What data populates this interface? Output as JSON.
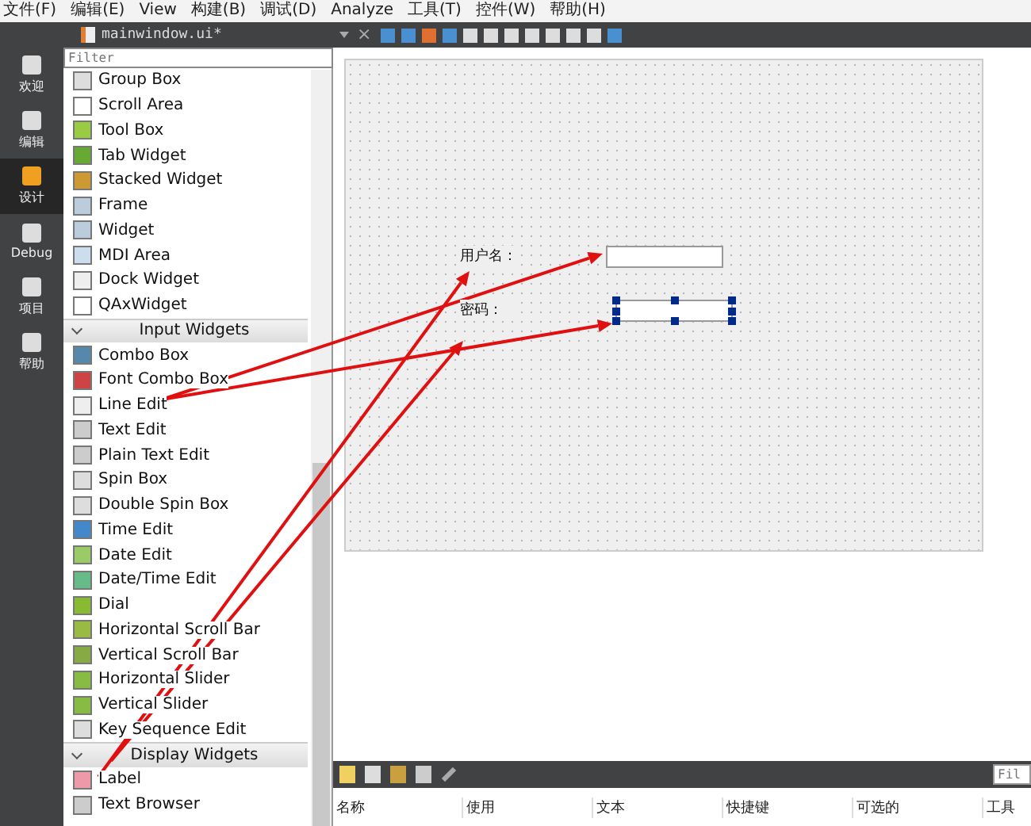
{
  "menu_bar": [
    "文件(F)",
    "编辑(E)",
    "View",
    "构建(B)",
    "调试(D)",
    "Analyze",
    "工具(T)",
    "控件(W)",
    "帮助(H)"
  ],
  "mode_bar": [
    {
      "label": "欢迎",
      "selected": false
    },
    {
      "label": "编辑",
      "selected": false
    },
    {
      "label": "设计",
      "selected": true
    },
    {
      "label": "Debug",
      "selected": false
    },
    {
      "label": "项目",
      "selected": false
    },
    {
      "label": "帮助",
      "selected": false
    }
  ],
  "editor_toolbar": {
    "file_tab": "mainwindow.ui*",
    "close": "×"
  },
  "widget_box": {
    "filter": {
      "placeholder": "Filter"
    },
    "items": [
      {
        "kind": "item",
        "label": "Group Box"
      },
      {
        "kind": "item",
        "label": "Scroll Area"
      },
      {
        "kind": "item",
        "label": "Tool Box"
      },
      {
        "kind": "item",
        "label": "Tab Widget"
      },
      {
        "kind": "item",
        "label": "Stacked Widget"
      },
      {
        "kind": "item",
        "label": "Frame"
      },
      {
        "kind": "item",
        "label": "Widget"
      },
      {
        "kind": "item",
        "label": "MDI Area"
      },
      {
        "kind": "item",
        "label": "Dock Widget"
      },
      {
        "kind": "item",
        "label": "QAxWidget"
      },
      {
        "kind": "category",
        "label": "Input Widgets",
        "expanded": true
      },
      {
        "kind": "item",
        "label": "Combo Box"
      },
      {
        "kind": "item",
        "label": "Font Combo Box"
      },
      {
        "kind": "item",
        "label": "Line Edit"
      },
      {
        "kind": "item",
        "label": "Text Edit"
      },
      {
        "kind": "item",
        "label": "Plain Text Edit"
      },
      {
        "kind": "item",
        "label": "Spin Box"
      },
      {
        "kind": "item",
        "label": "Double Spin Box"
      },
      {
        "kind": "item",
        "label": "Time Edit"
      },
      {
        "kind": "item",
        "label": "Date Edit"
      },
      {
        "kind": "item",
        "label": "Date/Time Edit"
      },
      {
        "kind": "item",
        "label": "Dial"
      },
      {
        "kind": "item",
        "label": "Horizontal Scroll Bar"
      },
      {
        "kind": "item",
        "label": "Vertical Scroll Bar"
      },
      {
        "kind": "item",
        "label": "Horizontal Slider"
      },
      {
        "kind": "item",
        "label": "Vertical Slider"
      },
      {
        "kind": "item",
        "label": "Key Sequence Edit"
      },
      {
        "kind": "category",
        "label": "Display Widgets",
        "expanded": true
      },
      {
        "kind": "item",
        "label": "Label"
      },
      {
        "kind": "item",
        "label": "Text Browser"
      }
    ]
  },
  "form": {
    "rows": [
      {
        "label": "用户名：",
        "selected": false
      },
      {
        "label": "密码：",
        "selected": true
      }
    ]
  },
  "action_editor": {
    "filter": {
      "placeholder": "Fil"
    },
    "columns": [
      "名称",
      "使用",
      "文本",
      "快捷键",
      "可选的",
      "工具"
    ]
  }
}
